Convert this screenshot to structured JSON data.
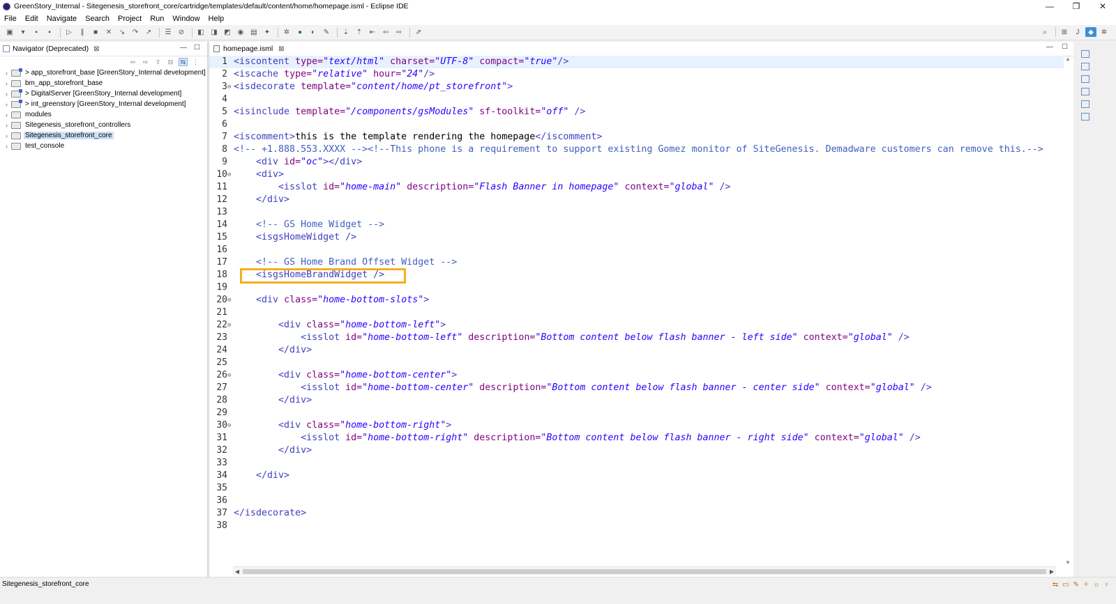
{
  "window": {
    "title": "GreenStory_Internal - Sitegenesis_storefront_core/cartridge/templates/default/content/home/homepage.isml - Eclipse IDE",
    "controls": [
      "—",
      "❐",
      "✕"
    ]
  },
  "menu": [
    "File",
    "Edit",
    "Navigate",
    "Search",
    "Project",
    "Run",
    "Window",
    "Help"
  ],
  "navigator": {
    "tab_label": "Navigator (Deprecated)",
    "tab_close": "⊠",
    "items": [
      {
        "label": "> app_storefront_base [GreenStory_Internal development]",
        "project": true,
        "selected": false
      },
      {
        "label": "bm_app_storefront_base",
        "project": false,
        "selected": false
      },
      {
        "label": "> DigitalServer [GreenStory_Internal development]",
        "project": true,
        "selected": false
      },
      {
        "label": "> int_greenstory [GreenStory_Internal development]",
        "project": true,
        "selected": false
      },
      {
        "label": "modules",
        "project": false,
        "selected": false
      },
      {
        "label": "Sitegenesis_storefront_controllers",
        "project": false,
        "selected": false
      },
      {
        "label": "Sitegenesis_storefront_core",
        "project": false,
        "selected": true
      },
      {
        "label": "test_console",
        "project": false,
        "selected": false
      }
    ]
  },
  "editor": {
    "tab_label": "homepage.isml",
    "tab_close": "⊠",
    "highlighted_line": 18,
    "lines": [
      {
        "n": "1",
        "fold": "",
        "seg": [
          [
            "tag",
            "<iscontent "
          ],
          [
            "attr",
            "type="
          ],
          [
            "val",
            "\"text/html\""
          ],
          [
            "plain",
            " "
          ],
          [
            "attr",
            "charset="
          ],
          [
            "val",
            "\"UTF-8\""
          ],
          [
            "plain",
            " "
          ],
          [
            "attr",
            "compact="
          ],
          [
            "val",
            "\"true\""
          ],
          [
            "tag",
            "/>"
          ]
        ]
      },
      {
        "n": "2",
        "fold": "",
        "seg": [
          [
            "tag",
            "<iscache "
          ],
          [
            "attr",
            "type="
          ],
          [
            "val",
            "\"relative\""
          ],
          [
            "plain",
            " "
          ],
          [
            "attr",
            "hour="
          ],
          [
            "val",
            "\"24\""
          ],
          [
            "tag",
            "/>"
          ]
        ]
      },
      {
        "n": "3",
        "fold": "⊖",
        "seg": [
          [
            "tag",
            "<isdecorate "
          ],
          [
            "attr",
            "template="
          ],
          [
            "val",
            "\"content/home/pt_storefront\""
          ],
          [
            "tag",
            ">"
          ]
        ]
      },
      {
        "n": "4",
        "fold": "",
        "seg": []
      },
      {
        "n": "5",
        "fold": "",
        "seg": [
          [
            "tag",
            "<isinclude "
          ],
          [
            "attr",
            "template="
          ],
          [
            "val",
            "\"/components/gsModules\""
          ],
          [
            "plain",
            " "
          ],
          [
            "attr",
            "sf-toolkit="
          ],
          [
            "val",
            "\"off\""
          ],
          [
            "plain",
            " "
          ],
          [
            "tag",
            "/>"
          ]
        ]
      },
      {
        "n": "6",
        "fold": "",
        "seg": []
      },
      {
        "n": "7",
        "fold": "",
        "seg": [
          [
            "tag",
            "<iscomment>"
          ],
          [
            "plain",
            "this is the template rendering the homepage"
          ],
          [
            "tag",
            "</iscomment>"
          ]
        ]
      },
      {
        "n": "8",
        "fold": "",
        "seg": [
          [
            "cmt",
            "<!-- +1.888.553.XXXX --><!--This phone is a requirement to support existing Gomez monitor of SiteGenesis. Demadware customers can remove this.-->"
          ]
        ]
      },
      {
        "n": "9",
        "fold": "",
        "seg": [
          [
            "plain",
            "    "
          ],
          [
            "tag",
            "<div "
          ],
          [
            "attr",
            "id="
          ],
          [
            "val",
            "\"oc\""
          ],
          [
            "tag",
            "></div>"
          ]
        ]
      },
      {
        "n": "10",
        "fold": "⊖",
        "seg": [
          [
            "plain",
            "    "
          ],
          [
            "tag",
            "<div>"
          ]
        ]
      },
      {
        "n": "11",
        "fold": "",
        "seg": [
          [
            "plain",
            "        "
          ],
          [
            "tag",
            "<isslot "
          ],
          [
            "attr",
            "id="
          ],
          [
            "val",
            "\"home-main\""
          ],
          [
            "plain",
            " "
          ],
          [
            "attr",
            "description="
          ],
          [
            "val",
            "\"Flash Banner in homepage\""
          ],
          [
            "plain",
            " "
          ],
          [
            "attr",
            "context="
          ],
          [
            "val",
            "\"global\""
          ],
          [
            "plain",
            " "
          ],
          [
            "tag",
            "/>"
          ]
        ]
      },
      {
        "n": "12",
        "fold": "",
        "seg": [
          [
            "plain",
            "    "
          ],
          [
            "tag",
            "</div>"
          ]
        ]
      },
      {
        "n": "13",
        "fold": "",
        "seg": []
      },
      {
        "n": "14",
        "fold": "",
        "seg": [
          [
            "plain",
            "    "
          ],
          [
            "cmt",
            "<!-- GS Home Widget -->"
          ]
        ]
      },
      {
        "n": "15",
        "fold": "",
        "seg": [
          [
            "plain",
            "    "
          ],
          [
            "tag",
            "<isgsHomeWidget />"
          ]
        ]
      },
      {
        "n": "16",
        "fold": "",
        "seg": []
      },
      {
        "n": "17",
        "fold": "",
        "seg": [
          [
            "plain",
            "    "
          ],
          [
            "cmt",
            "<!-- GS Home Brand Offset Widget -->"
          ]
        ]
      },
      {
        "n": "18",
        "fold": "",
        "seg": [
          [
            "plain",
            "    "
          ],
          [
            "tag",
            "<isgsHomeBrandWidget />"
          ]
        ]
      },
      {
        "n": "19",
        "fold": "",
        "seg": []
      },
      {
        "n": "20",
        "fold": "⊖",
        "seg": [
          [
            "plain",
            "    "
          ],
          [
            "tag",
            "<div "
          ],
          [
            "attr",
            "class="
          ],
          [
            "val",
            "\"home-bottom-slots\""
          ],
          [
            "tag",
            ">"
          ]
        ]
      },
      {
        "n": "21",
        "fold": "",
        "seg": []
      },
      {
        "n": "22",
        "fold": "⊖",
        "seg": [
          [
            "plain",
            "        "
          ],
          [
            "tag",
            "<div "
          ],
          [
            "attr",
            "class="
          ],
          [
            "val",
            "\"home-bottom-left\""
          ],
          [
            "tag",
            ">"
          ]
        ]
      },
      {
        "n": "23",
        "fold": "",
        "seg": [
          [
            "plain",
            "            "
          ],
          [
            "tag",
            "<isslot "
          ],
          [
            "attr",
            "id="
          ],
          [
            "val",
            "\"home-bottom-left\""
          ],
          [
            "plain",
            " "
          ],
          [
            "attr",
            "description="
          ],
          [
            "val",
            "\"Bottom content below flash banner - left side\""
          ],
          [
            "plain",
            " "
          ],
          [
            "attr",
            "context="
          ],
          [
            "val",
            "\"global\""
          ],
          [
            "plain",
            " "
          ],
          [
            "tag",
            "/>"
          ]
        ]
      },
      {
        "n": "24",
        "fold": "",
        "seg": [
          [
            "plain",
            "        "
          ],
          [
            "tag",
            "</div>"
          ]
        ]
      },
      {
        "n": "25",
        "fold": "",
        "seg": []
      },
      {
        "n": "26",
        "fold": "⊖",
        "seg": [
          [
            "plain",
            "        "
          ],
          [
            "tag",
            "<div "
          ],
          [
            "attr",
            "class="
          ],
          [
            "val",
            "\"home-bottom-center\""
          ],
          [
            "tag",
            ">"
          ]
        ]
      },
      {
        "n": "27",
        "fold": "",
        "seg": [
          [
            "plain",
            "            "
          ],
          [
            "tag",
            "<isslot "
          ],
          [
            "attr",
            "id="
          ],
          [
            "val",
            "\"home-bottom-center\""
          ],
          [
            "plain",
            " "
          ],
          [
            "attr",
            "description="
          ],
          [
            "val",
            "\"Bottom content below flash banner - center side\""
          ],
          [
            "plain",
            " "
          ],
          [
            "attr",
            "context="
          ],
          [
            "val",
            "\"global\""
          ],
          [
            "plain",
            " "
          ],
          [
            "tag",
            "/>"
          ]
        ]
      },
      {
        "n": "28",
        "fold": "",
        "seg": [
          [
            "plain",
            "        "
          ],
          [
            "tag",
            "</div>"
          ]
        ]
      },
      {
        "n": "29",
        "fold": "",
        "seg": []
      },
      {
        "n": "30",
        "fold": "⊖",
        "seg": [
          [
            "plain",
            "        "
          ],
          [
            "tag",
            "<div "
          ],
          [
            "attr",
            "class="
          ],
          [
            "val",
            "\"home-bottom-right\""
          ],
          [
            "tag",
            ">"
          ]
        ]
      },
      {
        "n": "31",
        "fold": "",
        "seg": [
          [
            "plain",
            "            "
          ],
          [
            "tag",
            "<isslot "
          ],
          [
            "attr",
            "id="
          ],
          [
            "val",
            "\"home-bottom-right\""
          ],
          [
            "plain",
            " "
          ],
          [
            "attr",
            "description="
          ],
          [
            "val",
            "\"Bottom content below flash banner - right side\""
          ],
          [
            "plain",
            " "
          ],
          [
            "attr",
            "context="
          ],
          [
            "val",
            "\"global\""
          ],
          [
            "plain",
            " "
          ],
          [
            "tag",
            "/>"
          ]
        ]
      },
      {
        "n": "32",
        "fold": "",
        "seg": [
          [
            "plain",
            "        "
          ],
          [
            "tag",
            "</div>"
          ]
        ]
      },
      {
        "n": "33",
        "fold": "",
        "seg": []
      },
      {
        "n": "34",
        "fold": "",
        "seg": [
          [
            "plain",
            "    "
          ],
          [
            "tag",
            "</div>"
          ]
        ]
      },
      {
        "n": "35",
        "fold": "",
        "seg": []
      },
      {
        "n": "36",
        "fold": "",
        "seg": []
      },
      {
        "n": "37",
        "fold": "",
        "seg": [
          [
            "tag",
            "</isdecorate>"
          ]
        ]
      },
      {
        "n": "38",
        "fold": "",
        "seg": []
      }
    ]
  },
  "status": {
    "selection": "Sitegenesis_storefront_core"
  },
  "colors": {
    "tag": "#3f3fbf",
    "attribute": "#7f007f",
    "value": "#2a00ff",
    "comment": "#3f5fbf",
    "highlight_box": "#f2b01e",
    "selection": "#cde0f7"
  }
}
